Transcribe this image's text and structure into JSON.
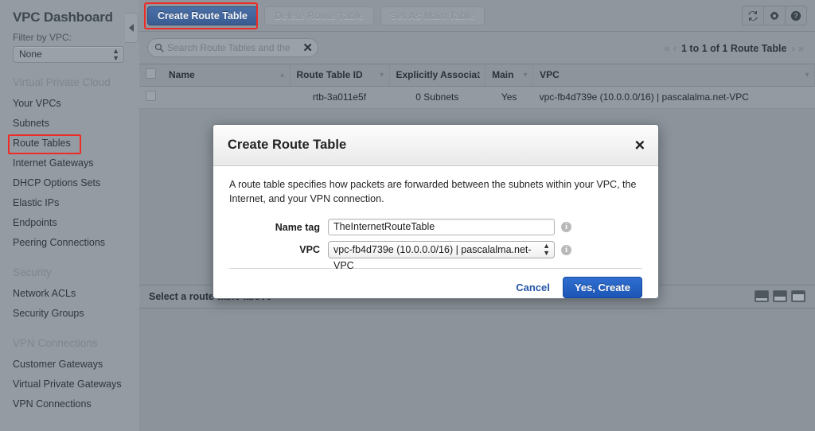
{
  "sidebar": {
    "title": "VPC Dashboard",
    "filter_label": "Filter by VPC:",
    "filter_value": "None",
    "groups": [
      {
        "heading": "Virtual Private Cloud",
        "items": [
          {
            "label": "Your VPCs",
            "highlighted": false
          },
          {
            "label": "Subnets",
            "highlighted": false
          },
          {
            "label": "Route Tables",
            "highlighted": true
          },
          {
            "label": "Internet Gateways",
            "highlighted": false
          },
          {
            "label": "DHCP Options Sets",
            "highlighted": false
          },
          {
            "label": "Elastic IPs",
            "highlighted": false
          },
          {
            "label": "Endpoints",
            "highlighted": false
          },
          {
            "label": "Peering Connections",
            "highlighted": false
          }
        ]
      },
      {
        "heading": "Security",
        "items": [
          {
            "label": "Network ACLs",
            "highlighted": false
          },
          {
            "label": "Security Groups",
            "highlighted": false
          }
        ]
      },
      {
        "heading": "VPN Connections",
        "items": [
          {
            "label": "Customer Gateways",
            "highlighted": false
          },
          {
            "label": "Virtual Private Gateways",
            "highlighted": false
          },
          {
            "label": "VPN Connections",
            "highlighted": false
          }
        ]
      }
    ]
  },
  "toolbar": {
    "create_label": "Create Route Table",
    "delete_label": "Delete Route Table",
    "set_main_label": "Set As Main Table",
    "refresh_icon": "refresh-icon",
    "settings_icon": "gear-icon",
    "help_icon": "help-icon"
  },
  "search": {
    "icon": "search-icon",
    "placeholder": "Search Route Tables and the",
    "clear": "✕"
  },
  "pager": {
    "first": "«",
    "prev": "‹",
    "label": "1 to 1 of 1 Route Table",
    "next": "›",
    "last": "»"
  },
  "table": {
    "columns": [
      {
        "label": "Name",
        "sort": "▲"
      },
      {
        "label": "Route Table ID",
        "sort": "▼"
      },
      {
        "label": "Explicitly Associat",
        "sort": "▼"
      },
      {
        "label": "Main",
        "sort": "▼"
      },
      {
        "label": "VPC",
        "sort": "▼"
      }
    ],
    "rows": [
      {
        "name": "",
        "route_table_id": "rtb-3a011e5f",
        "explicitly_associated": "0 Subnets",
        "main": "Yes",
        "vpc": "vpc-fb4d739e (10.0.0.0/16) | pascalalma.net-VPC"
      }
    ]
  },
  "bottom_panel": {
    "message": "Select a route table above",
    "layout_icons": [
      "panel-layout-small-icon",
      "panel-layout-medium-icon",
      "panel-layout-large-icon"
    ]
  },
  "modal": {
    "title": "Create Route Table",
    "close_icon": "✕",
    "description": "A route table specifies how packets are forwarded between the subnets within your VPC, the Internet, and your VPN connection.",
    "fields": [
      {
        "label": "Name tag",
        "value": "TheInternetRouteTable",
        "info": "i"
      },
      {
        "label": "VPC",
        "value": "vpc-fb4d739e (10.0.0.0/16) | pascalalma.net-VPC",
        "info": "i"
      }
    ],
    "cancel_label": "Cancel",
    "create_label": "Yes, Create"
  },
  "colors": {
    "page_background": "#8c939b",
    "sidebar_background": "#949ba3",
    "primary_button": "#3a5c91",
    "create_button": "#1c55b5",
    "highlight_outline": "#ee2b26",
    "link": "#2756a8"
  }
}
